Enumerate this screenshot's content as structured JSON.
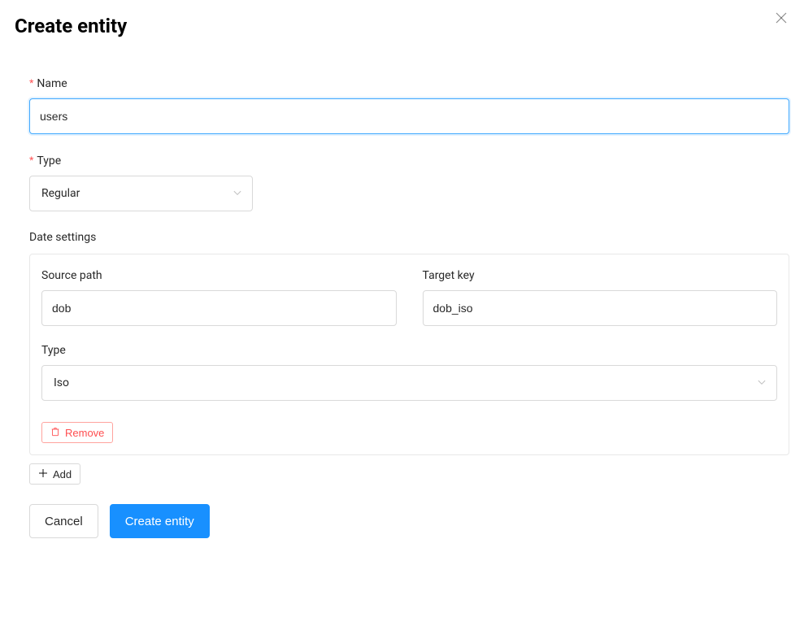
{
  "dialog": {
    "title": "Create entity",
    "closeIcon": "close"
  },
  "form": {
    "name": {
      "label": "Name",
      "value": "users"
    },
    "type": {
      "label": "Type",
      "value": "Regular"
    },
    "dateSettings": {
      "heading": "Date settings",
      "items": [
        {
          "sourcePathLabel": "Source path",
          "sourcePathValue": "dob",
          "targetKeyLabel": "Target key",
          "targetKeyValue": "dob_iso",
          "typeLabel": "Type",
          "typeValue": "Iso",
          "removeLabel": "Remove"
        }
      ],
      "addLabel": "Add"
    }
  },
  "footer": {
    "cancel": "Cancel",
    "submit": "Create entity"
  },
  "colors": {
    "primary": "#1890ff",
    "danger": "#ff4d4f"
  }
}
